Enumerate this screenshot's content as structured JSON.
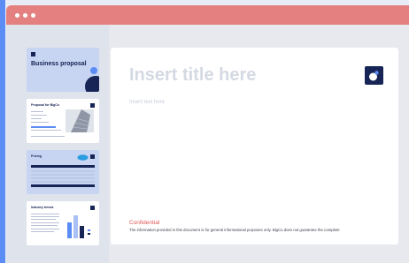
{
  "slides": [
    {
      "title": "Business proposal"
    },
    {
      "title": "Proposal for BigCo"
    },
    {
      "title": "Pricing"
    },
    {
      "title": "Industry trends"
    }
  ],
  "main": {
    "title": "Insert title here",
    "subtitle": "Insert text here",
    "confidential": "Confidential",
    "disclaimer": "The information provided in this document is for general informational purposes only. BigCo does not guarantee the complete"
  },
  "colors": {
    "accent_blue": "#5b8df5",
    "titlebar": "#e48180",
    "navy": "#162556",
    "confidential_red": "#e05655"
  }
}
